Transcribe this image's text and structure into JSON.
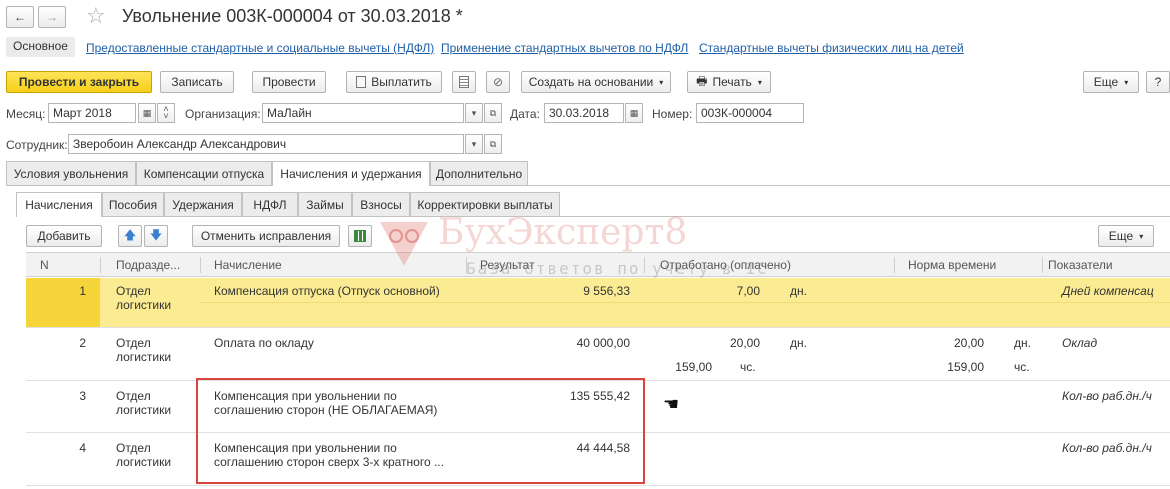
{
  "window": {
    "title": "Увольнение 003К-000004 от 30.03.2018 *",
    "back": "←",
    "forward": "→",
    "star": "☆"
  },
  "nav": {
    "main": "Основное",
    "links": [
      "Предоставленные стандартные и социальные вычеты (НДФЛ)",
      "Применение стандартных вычетов по НДФЛ",
      "Стандартные вычеты физических лиц на детей"
    ]
  },
  "toolbar": {
    "post_close": "Провести и закрыть",
    "save": "Записать",
    "post": "Провести",
    "pay": "Выплатить",
    "create_based": "Создать на основании",
    "print": "Печать",
    "more": "Еще",
    "help": "?"
  },
  "form": {
    "month_label": "Месяц:",
    "month_value": "Март 2018",
    "org_label": "Организация:",
    "org_value": "МаЛайн",
    "date_label": "Дата:",
    "date_value": "30.03.2018",
    "number_label": "Номер:",
    "number_value": "003К-000004",
    "employee_label": "Сотрудник:",
    "employee_value": "Зверобоин Александр Александрович"
  },
  "tabs": [
    "Условия увольнения",
    "Компенсации отпуска",
    "Начисления и удержания",
    "Дополнительно"
  ],
  "subtabs": [
    "Начисления",
    "Пособия",
    "Удержания",
    "НДФЛ",
    "Займы",
    "Взносы",
    "Корректировки выплаты"
  ],
  "subtoolbar": {
    "add": "Добавить",
    "cancel_fix": "Отменить исправления",
    "more": "Еще"
  },
  "watermark": {
    "title": "БухЭксперт8",
    "subtitle": "База ответов по учету в 1С"
  },
  "table": {
    "headers": [
      "N",
      "Подразде...",
      "Начисление",
      "Результат",
      "Отработано (оплачено)",
      "Норма времени",
      "Показатели"
    ],
    "rows": [
      {
        "n": "1",
        "dept1": "Отдел",
        "dept2": "логистики",
        "acc1": "Компенсация отпуска (Отпуск основной)",
        "acc2": "",
        "result": "9 556,33",
        "worked": "7,00",
        "worked_unit": "дн.",
        "worked2": "",
        "worked2_unit": "",
        "worked2_left": "",
        "norm": "",
        "norm_unit": "",
        "norm2": "",
        "norm2_unit": "",
        "indicator": "Дней компенсац"
      },
      {
        "n": "2",
        "dept1": "Отдел",
        "dept2": "логистики",
        "acc1": "Оплата по окладу",
        "acc2": "",
        "result": "40 000,00",
        "worked": "20,00",
        "worked_unit": "дн.",
        "worked2_left": "159,00",
        "worked2_unit": "чс.",
        "norm": "20,00",
        "norm_unit": "дн.",
        "norm2": "159,00",
        "norm2_unit": "чс.",
        "indicator": "Оклад"
      },
      {
        "n": "3",
        "dept1": "Отдел",
        "dept2": "логистики",
        "acc1": "Компенсация при увольнении по",
        "acc2": "соглашению сторон (НЕ ОБЛАГАЕМАЯ)",
        "result": "135 555,42",
        "worked": "",
        "worked_unit": "",
        "worked2_left": "",
        "worked2_unit": "",
        "norm": "",
        "norm_unit": "",
        "norm2": "",
        "norm2_unit": "",
        "indicator": "Кол-во раб.дн./ч"
      },
      {
        "n": "4",
        "dept1": "Отдел",
        "dept2": "логистики",
        "acc1": "Компенсация при увольнении по",
        "acc2": "соглашению сторон сверх 3-х кратного ...",
        "result": "44 444,58",
        "worked": "",
        "worked_unit": "",
        "worked2_left": "",
        "worked2_unit": "",
        "norm": "",
        "norm_unit": "",
        "norm2": "",
        "norm2_unit": "",
        "indicator": "Кол-во раб.дн./ч"
      }
    ]
  },
  "colors": {
    "selected_row": "#fbec93",
    "selected_row_n": "#f5d53a",
    "highlight_box": "#d9453c",
    "link": "#1f5fa8"
  }
}
